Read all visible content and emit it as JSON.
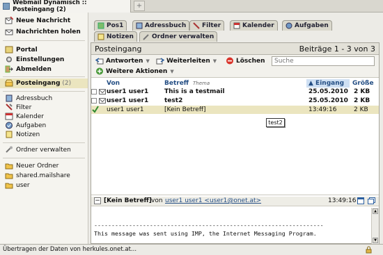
{
  "browser": {
    "tab_title": "Webmail Dynamisch :: Posteingang (2)",
    "new_tab_label": "+",
    "status_text": "Übertragen der Daten von herkules.onet.at..."
  },
  "sidebar": {
    "top": [
      {
        "label": "Neue Nachricht",
        "icon": "new-message-icon"
      },
      {
        "label": "Nachrichten holen",
        "icon": "get-mail-icon"
      }
    ],
    "portal": [
      {
        "label": "Portal",
        "icon": "portal-icon"
      },
      {
        "label": "Einstellungen",
        "icon": "settings-icon"
      },
      {
        "label": "Abmelden",
        "icon": "logout-icon"
      }
    ],
    "inbox": {
      "label": "Posteingang",
      "count": "(2)"
    },
    "apps": [
      {
        "label": "Adressbuch",
        "icon": "addressbook-icon"
      },
      {
        "label": "Filter",
        "icon": "filter-icon"
      },
      {
        "label": "Kalender",
        "icon": "calendar-icon"
      },
      {
        "label": "Aufgaben",
        "icon": "tasks-icon"
      },
      {
        "label": "Notizen",
        "icon": "notes-icon"
      }
    ],
    "manage": {
      "label": "Ordner verwalten",
      "icon": "folder-manage-icon"
    },
    "folders": [
      {
        "label": "Neuer Ordner",
        "icon": "folder-icon"
      },
      {
        "label": "shared.mailshare",
        "icon": "folder-icon"
      },
      {
        "label": "user",
        "icon": "folder-icon"
      }
    ]
  },
  "tabs": {
    "row1": [
      "Pos1",
      "Adressbuch",
      "Filter",
      "Kalender",
      "Aufgaben"
    ],
    "row2": [
      "Notizen",
      "Ordner verwalten"
    ]
  },
  "mailbox": {
    "title": "Posteingang",
    "range": "Beiträge 1 - 3 von 3",
    "search_placeholder": "Suche"
  },
  "toolbar": {
    "reply": "Antworten",
    "forward": "Weiterleiten",
    "delete": "Löschen",
    "more": "Weitere Aktionen"
  },
  "columns": {
    "from": "Von",
    "subject": "Betreff",
    "thread": "Thema",
    "date": "▲ Eingang",
    "size": "Größe"
  },
  "messages": [
    {
      "from": "user1 user1",
      "subject": "This is a testmail",
      "date": "25.05.2010",
      "size": "2 KB"
    },
    {
      "from": "user1 user1",
      "subject": "test2",
      "date": "25.05.2010",
      "size": "2 KB"
    },
    {
      "from": "user1 user1",
      "subject": "[Kein Betreff]",
      "date": "13:49:16",
      "size": "2 KB"
    }
  ],
  "tooltip": "test2",
  "preview": {
    "toggle": "−",
    "subject": "[Kein Betreff]",
    "von": "von",
    "sender": "user1 user1 <user1@onet.at>",
    "time": "13:49:16",
    "line1": "------------------------------------------------------------------",
    "line2": "This message was sent using IMP, the Internet Messaging Program."
  },
  "colors": {
    "selection": "#ebe5bf",
    "link": "#244e84",
    "accent": "#2b5fa0"
  }
}
